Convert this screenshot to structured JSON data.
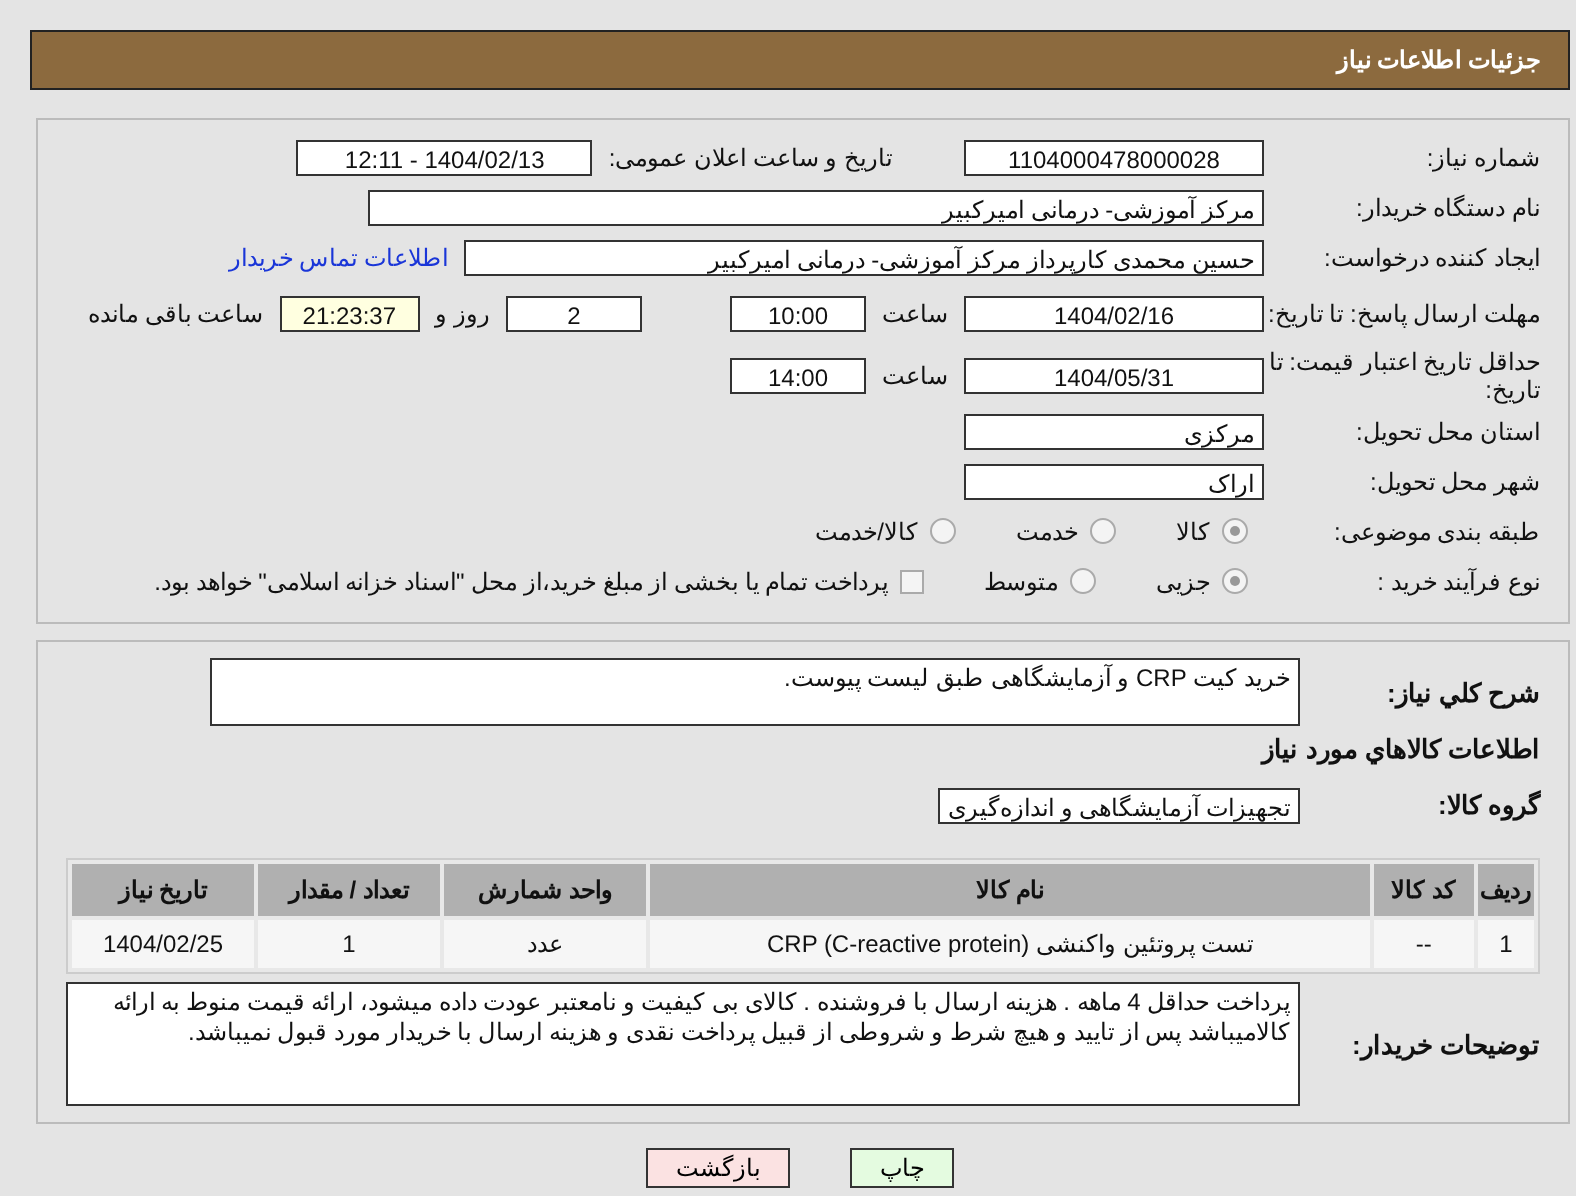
{
  "header": {
    "title": "جزئیات اطلاعات نیاز"
  },
  "info": {
    "need_number": {
      "label": "شماره نیاز:",
      "value": "1104000478000028"
    },
    "announce": {
      "label": "تاریخ و ساعت اعلان عمومی:",
      "value": "1404/02/13 - 12:11"
    },
    "buyer_org": {
      "label": "نام دستگاه خریدار:",
      "value": "مرکز آموزشی- درمانی امیرکبیر"
    },
    "requester": {
      "label": "ایجاد کننده درخواست:",
      "value": "حسین  محمدی کارپرداز مرکز آموزشی- درمانی امیرکبیر",
      "link": "اطلاعات تماس خریدار"
    },
    "deadline": {
      "label": "مهلت ارسال پاسخ: تا تاریخ:",
      "date": "1404/02/16",
      "time_label": "ساعت",
      "time": "10:00",
      "days": "2",
      "days_label": "روز و",
      "remaining": "21:23:37",
      "remaining_label": "ساعت باقی مانده"
    },
    "validity": {
      "label": "حداقل تاريخ اعتبار قيمت: تا تاريخ:",
      "date": "1404/05/31",
      "time_label": "ساعت",
      "time": "14:00"
    },
    "province": {
      "label": "استان محل تحویل:",
      "value": "مرکزی"
    },
    "city": {
      "label": "شهر محل تحویل:",
      "value": "اراک"
    },
    "category": {
      "label": "طبقه بندی موضوعی:",
      "options": [
        {
          "label": "کالا",
          "selected": true
        },
        {
          "label": "خدمت",
          "selected": false
        },
        {
          "label": "کالا/خدمت",
          "selected": false
        }
      ]
    },
    "process": {
      "label": "نوع فرآیند خرید :",
      "options": [
        {
          "label": "جزیی",
          "selected": true
        },
        {
          "label": "متوسط",
          "selected": false
        }
      ],
      "treasury": {
        "label": "پرداخت تمام یا بخشی از مبلغ خرید،از محل \"اسناد خزانه اسلامی\" خواهد بود.",
        "checked": false
      }
    }
  },
  "details": {
    "description": {
      "label": "شرح کلي نياز:",
      "value": "خرید کیت CRP و آزمایشگاهی طبق لیست پیوست."
    },
    "goods_heading": "اطلاعات کالاهاي مورد نياز",
    "goods_group": {
      "label": "گروه کالا:",
      "value": "تجهیزات آزمایشگاهی و اندازه‌گیری"
    },
    "table": {
      "columns": [
        "ردیف",
        "کد کالا",
        "نام کالا",
        "واحد شمارش",
        "تعداد / مقدار",
        "تاریخ نیاز"
      ],
      "rows": [
        [
          "1",
          "--",
          "تست پروتئین واکنشی (CRP (C-reactive protein",
          "عدد",
          "1",
          "1404/02/25"
        ]
      ]
    },
    "notes": {
      "label": "توضیحات خریدار:",
      "value": "پرداخت حداقل 4 ماهه . هزینه ارسال با فروشنده .  کالای بی کیفیت و نامعتبر عودت داده میشود، ارائه قیمت منوط به ارائه کالامیباشد پس از تایید و هیچ شرط و شروطی از قبیل پرداخت نقدی و هزینه ارسال با خریدار مورد قبول نمیباشد."
    }
  },
  "buttons": [
    {
      "label": "چاپ",
      "kind": "print"
    },
    {
      "label": "بازگشت",
      "kind": "back"
    }
  ]
}
